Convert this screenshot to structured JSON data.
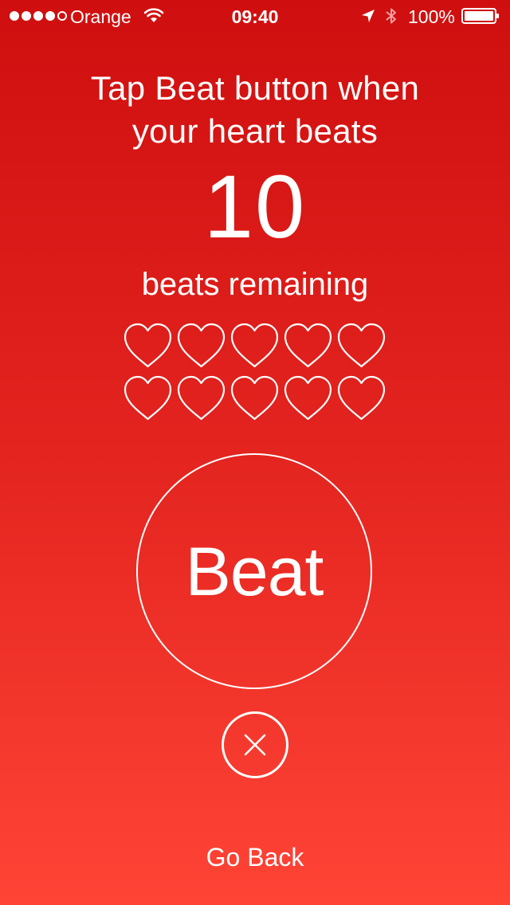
{
  "status_bar": {
    "signal_bars_filled": 4,
    "signal_bars_total": 5,
    "carrier": "Orange",
    "time": "09:40",
    "battery": "100%",
    "icons": [
      "wifi-icon",
      "location-arrow-icon",
      "bluetooth-icon",
      "battery-icon"
    ]
  },
  "instruction": {
    "line1": "Tap Beat button when",
    "line2": "your heart beats"
  },
  "counter": {
    "value": "10",
    "label": "beats remaining"
  },
  "hearts": {
    "total": 10,
    "filled": 0,
    "icon": "heart-outline-icon"
  },
  "beat_button": {
    "label": "Beat"
  },
  "close_button": {
    "icon": "close-icon"
  },
  "footer": {
    "go_back_label": "Go Back"
  },
  "colors": {
    "gradient_top": "#cf0f0f",
    "gradient_bottom": "#ff4436",
    "foreground": "#ffffff"
  }
}
